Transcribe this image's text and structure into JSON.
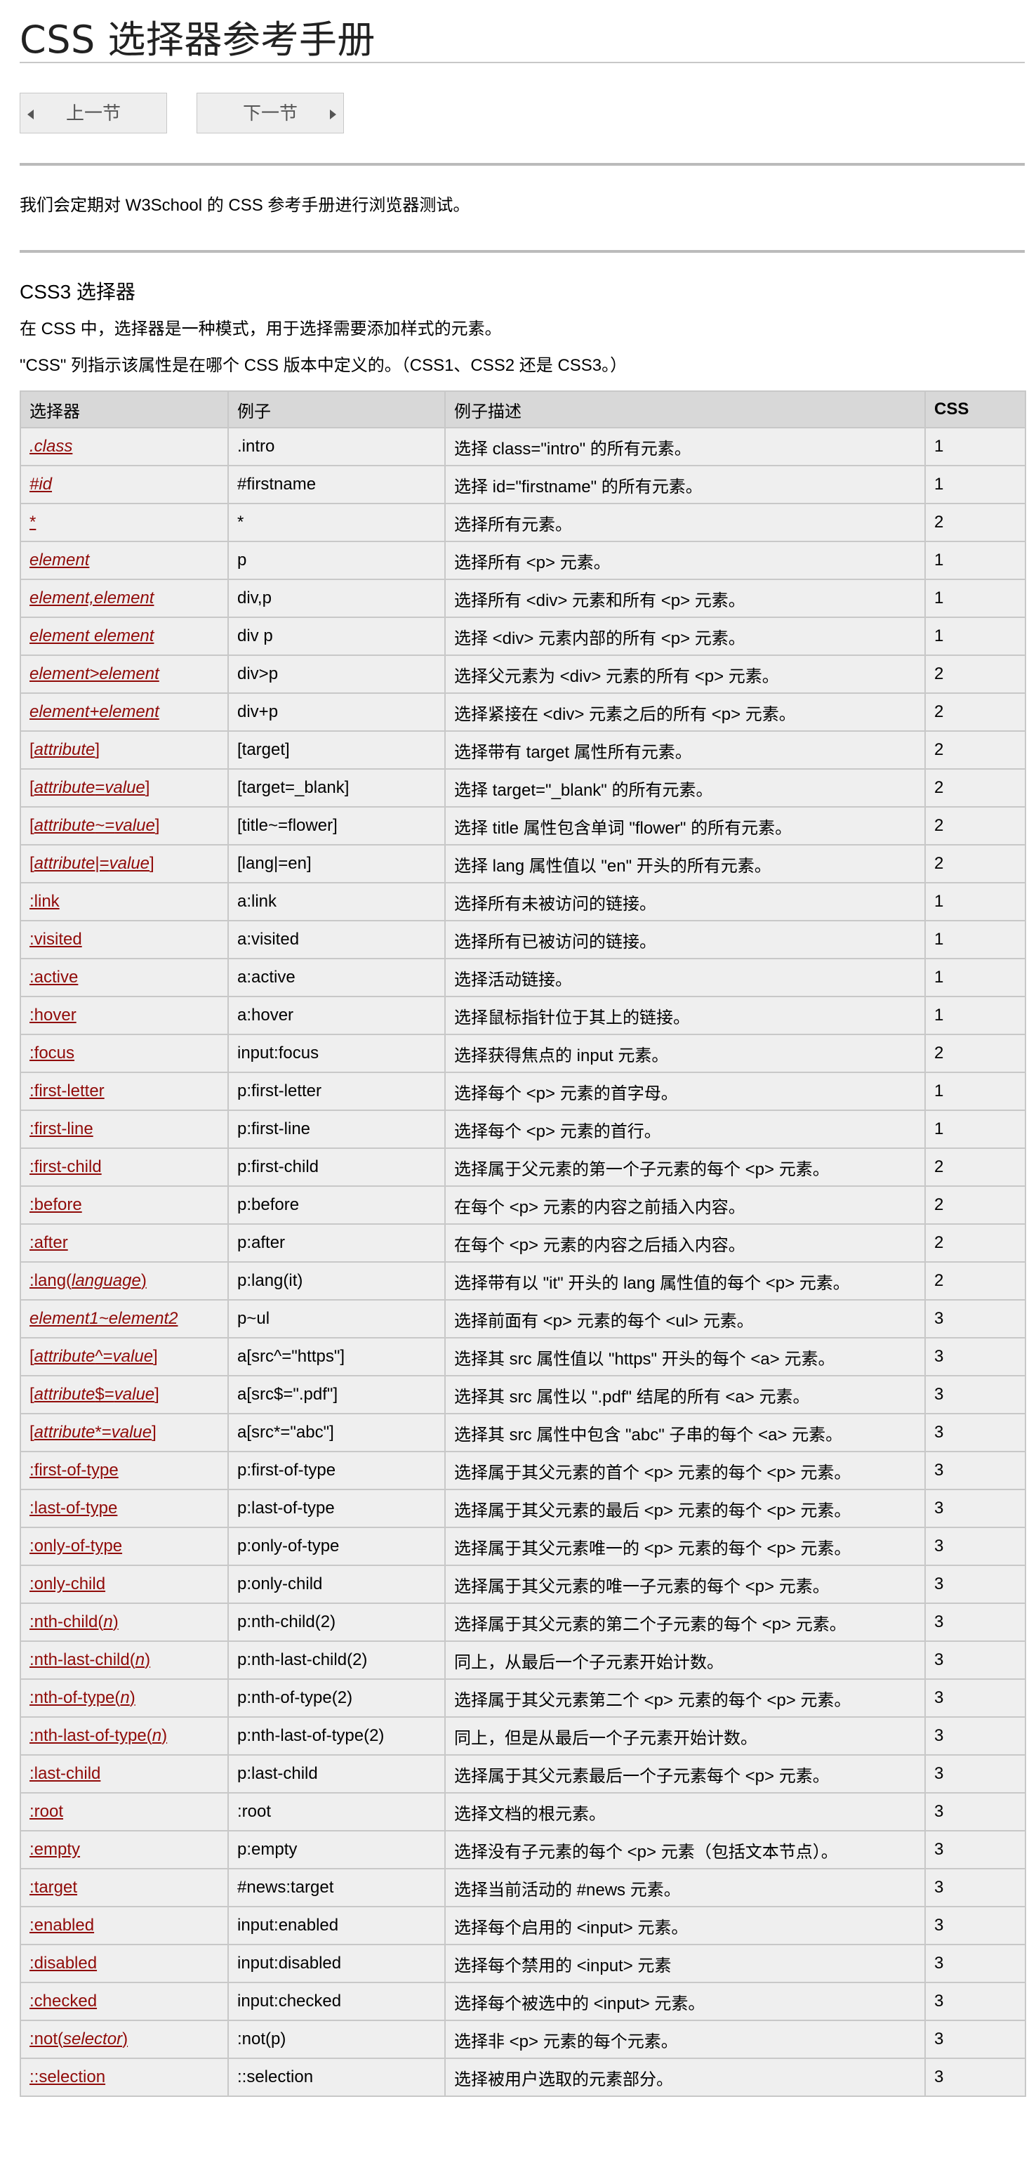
{
  "page": {
    "title": "CSS 选择器参考手册",
    "prev_label": "上一节",
    "next_label": "下一节",
    "intro": "我们会定期对 W3School 的 CSS 参考手册进行浏览器测试。",
    "section_title": "CSS3 选择器",
    "desc1": "在 CSS 中，选择器是一种模式，用于选择需要添加样式的元素。",
    "desc2": "\"CSS\" 列指示该属性是在哪个 CSS 版本中定义的。（CSS1、CSS2 还是 CSS3。）"
  },
  "colors": {
    "link": "#900b09",
    "header_bg": "#d8d8d8",
    "cell_bg": "#efefef",
    "border": "#c8c8c8"
  },
  "table": {
    "headers": [
      "选择器",
      "例子",
      "例子描述",
      "CSS"
    ],
    "rows": [
      {
        "selector": [
          {
            "t": ".class",
            "i": true
          }
        ],
        "example": ".intro",
        "desc": "选择 class=\"intro\" 的所有元素。",
        "css": "1"
      },
      {
        "selector": [
          {
            "t": "#id",
            "i": true
          }
        ],
        "example": "#firstname",
        "desc": "选择 id=\"firstname\" 的所有元素。",
        "css": "1"
      },
      {
        "selector": [
          {
            "t": "*",
            "i": false
          }
        ],
        "example": "*",
        "desc": "选择所有元素。",
        "css": "2"
      },
      {
        "selector": [
          {
            "t": "element",
            "i": true
          }
        ],
        "example": "p",
        "desc": "选择所有 <p> 元素。",
        "css": "1"
      },
      {
        "selector": [
          {
            "t": "element,element",
            "i": true
          }
        ],
        "example": "div,p",
        "desc": "选择所有 <div> 元素和所有 <p> 元素。",
        "css": "1"
      },
      {
        "selector": [
          {
            "t": "element element",
            "i": true
          }
        ],
        "example": "div p",
        "desc": "选择 <div> 元素内部的所有 <p> 元素。",
        "css": "1"
      },
      {
        "selector": [
          {
            "t": "element>element",
            "i": true
          }
        ],
        "example": "div>p",
        "desc": "选择父元素为 <div> 元素的所有 <p> 元素。",
        "css": "2"
      },
      {
        "selector": [
          {
            "t": "element+element",
            "i": true
          }
        ],
        "example": "div+p",
        "desc": "选择紧接在 <div> 元素之后的所有 <p> 元素。",
        "css": "2"
      },
      {
        "selector": [
          {
            "t": "[",
            "i": false
          },
          {
            "t": "attribute",
            "i": true
          },
          {
            "t": "]",
            "i": false
          }
        ],
        "example": "[target]",
        "desc": "选择带有 target 属性所有元素。",
        "css": "2"
      },
      {
        "selector": [
          {
            "t": "[",
            "i": false
          },
          {
            "t": "attribute",
            "i": true
          },
          {
            "t": "=",
            "i": false
          },
          {
            "t": "value",
            "i": true
          },
          {
            "t": "]",
            "i": false
          }
        ],
        "example": "[target=_blank]",
        "desc": "选择 target=\"_blank\" 的所有元素。",
        "css": "2"
      },
      {
        "selector": [
          {
            "t": "[",
            "i": false
          },
          {
            "t": "attribute",
            "i": true
          },
          {
            "t": "~=",
            "i": false
          },
          {
            "t": "value",
            "i": true
          },
          {
            "t": "]",
            "i": false
          }
        ],
        "example": "[title~=flower]",
        "desc": "选择 title 属性包含单词 \"flower\" 的所有元素。",
        "css": "2"
      },
      {
        "selector": [
          {
            "t": "[",
            "i": false
          },
          {
            "t": "attribute",
            "i": true
          },
          {
            "t": "|=",
            "i": false
          },
          {
            "t": "value",
            "i": true
          },
          {
            "t": "]",
            "i": false
          }
        ],
        "example": "[lang|=en]",
        "desc": "选择 lang 属性值以 \"en\" 开头的所有元素。",
        "css": "2"
      },
      {
        "selector": [
          {
            "t": ":link",
            "i": false
          }
        ],
        "example": "a:link",
        "desc": "选择所有未被访问的链接。",
        "css": "1"
      },
      {
        "selector": [
          {
            "t": ":visited",
            "i": false
          }
        ],
        "example": "a:visited",
        "desc": "选择所有已被访问的链接。",
        "css": "1"
      },
      {
        "selector": [
          {
            "t": ":active",
            "i": false
          }
        ],
        "example": "a:active",
        "desc": "选择活动链接。",
        "css": "1"
      },
      {
        "selector": [
          {
            "t": ":hover",
            "i": false
          }
        ],
        "example": "a:hover",
        "desc": "选择鼠标指针位于其上的链接。",
        "css": "1"
      },
      {
        "selector": [
          {
            "t": ":focus",
            "i": false
          }
        ],
        "example": "input:focus",
        "desc": "选择获得焦点的 input 元素。",
        "css": "2"
      },
      {
        "selector": [
          {
            "t": ":first-letter",
            "i": false
          }
        ],
        "example": "p:first-letter",
        "desc": "选择每个 <p> 元素的首字母。",
        "css": "1"
      },
      {
        "selector": [
          {
            "t": ":first-line",
            "i": false
          }
        ],
        "example": "p:first-line",
        "desc": "选择每个 <p> 元素的首行。",
        "css": "1"
      },
      {
        "selector": [
          {
            "t": ":first-child",
            "i": false
          }
        ],
        "example": "p:first-child",
        "desc": "选择属于父元素的第一个子元素的每个 <p> 元素。",
        "css": "2"
      },
      {
        "selector": [
          {
            "t": ":before",
            "i": false
          }
        ],
        "example": "p:before",
        "desc": "在每个 <p> 元素的内容之前插入内容。",
        "css": "2"
      },
      {
        "selector": [
          {
            "t": ":after",
            "i": false
          }
        ],
        "example": "p:after",
        "desc": "在每个 <p> 元素的内容之后插入内容。",
        "css": "2"
      },
      {
        "selector": [
          {
            "t": ":lang(",
            "i": false
          },
          {
            "t": "language",
            "i": true
          },
          {
            "t": ")",
            "i": false
          }
        ],
        "example": "p:lang(it)",
        "desc": "选择带有以 \"it\" 开头的 lang 属性值的每个 <p> 元素。",
        "css": "2"
      },
      {
        "selector": [
          {
            "t": "element1~element2",
            "i": true
          }
        ],
        "example": "p~ul",
        "desc": "选择前面有 <p> 元素的每个 <ul> 元素。",
        "css": "3"
      },
      {
        "selector": [
          {
            "t": "[",
            "i": false
          },
          {
            "t": "attribute",
            "i": true
          },
          {
            "t": "^=",
            "i": false
          },
          {
            "t": "value",
            "i": true
          },
          {
            "t": "]",
            "i": false
          }
        ],
        "example": "a[src^=\"https\"]",
        "desc": "选择其 src 属性值以 \"https\" 开头的每个 <a> 元素。",
        "css": "3"
      },
      {
        "selector": [
          {
            "t": "[",
            "i": false
          },
          {
            "t": "attribute",
            "i": true
          },
          {
            "t": "$=",
            "i": false
          },
          {
            "t": "value",
            "i": true
          },
          {
            "t": "]",
            "i": false
          }
        ],
        "example": "a[src$=\".pdf\"]",
        "desc": "选择其 src 属性以 \".pdf\" 结尾的所有 <a> 元素。",
        "css": "3"
      },
      {
        "selector": [
          {
            "t": "[",
            "i": false
          },
          {
            "t": "attribute",
            "i": true
          },
          {
            "t": "*=",
            "i": false
          },
          {
            "t": "value",
            "i": true
          },
          {
            "t": "]",
            "i": false
          }
        ],
        "example": "a[src*=\"abc\"]",
        "desc": "选择其 src 属性中包含 \"abc\" 子串的每个 <a> 元素。",
        "css": "3"
      },
      {
        "selector": [
          {
            "t": ":first-of-type",
            "i": false
          }
        ],
        "example": "p:first-of-type",
        "desc": "选择属于其父元素的首个 <p> 元素的每个 <p> 元素。",
        "css": "3"
      },
      {
        "selector": [
          {
            "t": ":last-of-type",
            "i": false
          }
        ],
        "example": "p:last-of-type",
        "desc": "选择属于其父元素的最后 <p> 元素的每个 <p> 元素。",
        "css": "3"
      },
      {
        "selector": [
          {
            "t": ":only-of-type",
            "i": false
          }
        ],
        "example": "p:only-of-type",
        "desc": "选择属于其父元素唯一的 <p> 元素的每个 <p> 元素。",
        "css": "3"
      },
      {
        "selector": [
          {
            "t": ":only-child",
            "i": false
          }
        ],
        "example": "p:only-child",
        "desc": "选择属于其父元素的唯一子元素的每个 <p> 元素。",
        "css": "3"
      },
      {
        "selector": [
          {
            "t": ":nth-child(",
            "i": false
          },
          {
            "t": "n",
            "i": true
          },
          {
            "t": ")",
            "i": false
          }
        ],
        "example": "p:nth-child(2)",
        "desc": "选择属于其父元素的第二个子元素的每个 <p> 元素。",
        "css": "3"
      },
      {
        "selector": [
          {
            "t": ":nth-last-child(",
            "i": false
          },
          {
            "t": "n",
            "i": true
          },
          {
            "t": ")",
            "i": false
          }
        ],
        "example": "p:nth-last-child(2)",
        "desc": "同上，从最后一个子元素开始计数。",
        "css": "3"
      },
      {
        "selector": [
          {
            "t": ":nth-of-type(",
            "i": false
          },
          {
            "t": "n",
            "i": true
          },
          {
            "t": ")",
            "i": false
          }
        ],
        "example": "p:nth-of-type(2)",
        "desc": "选择属于其父元素第二个 <p> 元素的每个 <p> 元素。",
        "css": "3"
      },
      {
        "selector": [
          {
            "t": ":nth-last-of-type(",
            "i": false
          },
          {
            "t": "n",
            "i": true
          },
          {
            "t": ")",
            "i": false
          }
        ],
        "example": "p:nth-last-of-type(2)",
        "desc": "同上，但是从最后一个子元素开始计数。",
        "css": "3"
      },
      {
        "selector": [
          {
            "t": ":last-child",
            "i": false
          }
        ],
        "example": "p:last-child",
        "desc": "选择属于其父元素最后一个子元素每个 <p> 元素。",
        "css": "3"
      },
      {
        "selector": [
          {
            "t": ":root",
            "i": false
          }
        ],
        "example": ":root",
        "desc": "选择文档的根元素。",
        "css": "3"
      },
      {
        "selector": [
          {
            "t": ":empty",
            "i": false
          }
        ],
        "example": "p:empty",
        "desc": "选择没有子元素的每个 <p> 元素（包括文本节点）。",
        "css": "3"
      },
      {
        "selector": [
          {
            "t": ":target",
            "i": false
          }
        ],
        "example": "#news:target",
        "desc": "选择当前活动的 #news 元素。",
        "css": "3"
      },
      {
        "selector": [
          {
            "t": ":enabled",
            "i": false
          }
        ],
        "example": "input:enabled",
        "desc": "选择每个启用的 <input> 元素。",
        "css": "3"
      },
      {
        "selector": [
          {
            "t": ":disabled",
            "i": false
          }
        ],
        "example": "input:disabled",
        "desc": "选择每个禁用的 <input> 元素",
        "css": "3"
      },
      {
        "selector": [
          {
            "t": ":checked",
            "i": false
          }
        ],
        "example": "input:checked",
        "desc": "选择每个被选中的 <input> 元素。",
        "css": "3"
      },
      {
        "selector": [
          {
            "t": ":not(",
            "i": false
          },
          {
            "t": "selector",
            "i": true
          },
          {
            "t": ")",
            "i": false
          }
        ],
        "example": ":not(p)",
        "desc": "选择非 <p> 元素的每个元素。",
        "css": "3"
      },
      {
        "selector": [
          {
            "t": "::selection",
            "i": false
          }
        ],
        "example": "::selection",
        "desc": "选择被用户选取的元素部分。",
        "css": "3"
      }
    ]
  }
}
